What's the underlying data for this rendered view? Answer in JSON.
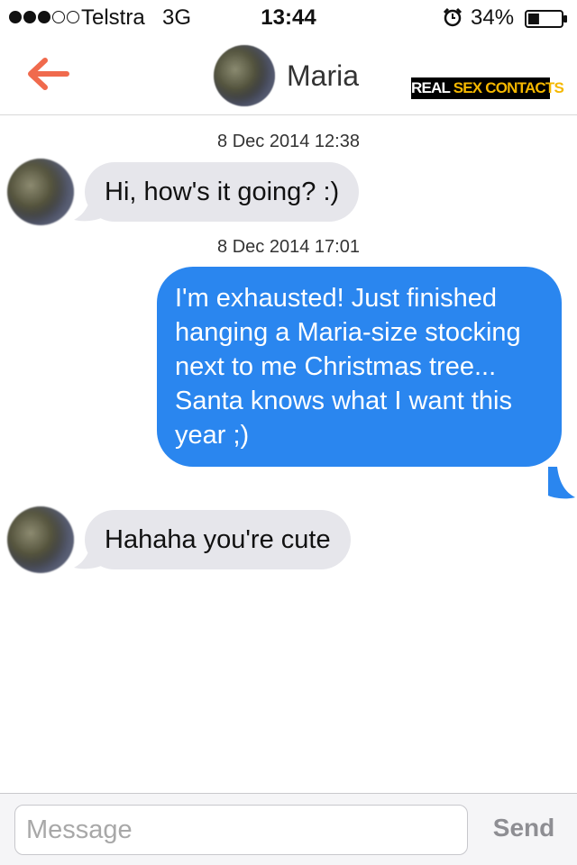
{
  "status_bar": {
    "carrier": "Telstra",
    "network": "3G",
    "time": "13:44",
    "battery_percent": "34%",
    "battery_level": 0.34,
    "signal_strength": 3,
    "signal_max": 5,
    "alarm_icon": "alarm-clock-icon",
    "battery_icon": "battery-icon"
  },
  "header": {
    "back_icon": "arrow-left-icon",
    "contact_name": "Maria",
    "accent_color": "#f06a4d"
  },
  "watermark": {
    "word1": "REAL",
    "word2": "SEX CONTACTS",
    "text_color": "#ffffff",
    "highlight_color": "#f5b800"
  },
  "messages": [
    {
      "timestamp": "8 Dec 2014 12:38"
    },
    {
      "sender": "contact",
      "text": "Hi, how's it going? :)"
    },
    {
      "timestamp": "8 Dec 2014 17:01"
    },
    {
      "sender": "me",
      "text": "I'm exhausted! Just finished hanging a Maria-size stocking next to me Christmas tree... Santa knows what I want this year ;)"
    },
    {
      "sender": "contact",
      "text": "Hahaha you're cute"
    }
  ],
  "composer": {
    "placeholder": "Message",
    "value": "",
    "send_label": "Send"
  },
  "colors": {
    "incoming_bubble": "#e6e6eb",
    "outgoing_bubble": "#2a86ef"
  }
}
